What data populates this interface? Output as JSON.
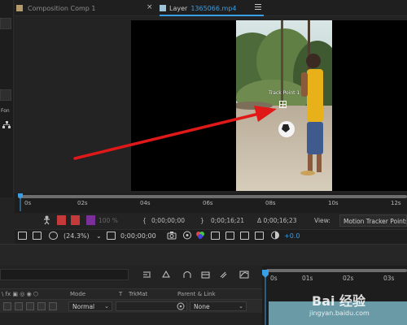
{
  "tabs": {
    "comp_title": "Composition Comp 1",
    "layer_prefix": "Layer",
    "layer_file": "1365066.mp4",
    "close_glyph": "×"
  },
  "left_panel": {
    "label": "Fon"
  },
  "viewer": {
    "track_point_label": "Track Point 1"
  },
  "ruler": {
    "ticks": [
      "0s",
      "02s",
      "04s",
      "06s",
      "08s",
      "10s",
      "12s"
    ]
  },
  "info_row": {
    "opacity_text": "100 %",
    "in_time": "0;00;00;00",
    "out_time": "0;00;16;21",
    "duration_text": "Δ 0;00;16;23",
    "view_label": "View:",
    "view_value": "Motion Tracker Points"
  },
  "controls": {
    "zoom": "(24.3%)",
    "zoom_chevron": "⌄",
    "timecode": "0;00;00;00",
    "exposure": "+0.0"
  },
  "timeline": {
    "ticks": [
      "0s",
      "01s",
      "02s",
      "03s"
    ],
    "headers": {
      "mode": "Mode",
      "t": "T",
      "trkmat": "TrkMat",
      "parent": "Parent & Link"
    },
    "mode_value": "Normal",
    "parent_value": "None",
    "chevron": "⌄"
  },
  "watermark": {
    "main": "Bai 经验",
    "sub": "jingyan.baidu.com"
  },
  "colors": {
    "accent_blue": "#3a9ee6",
    "arrow_red": "#e01818",
    "track_teal": "#6a9aa6"
  }
}
